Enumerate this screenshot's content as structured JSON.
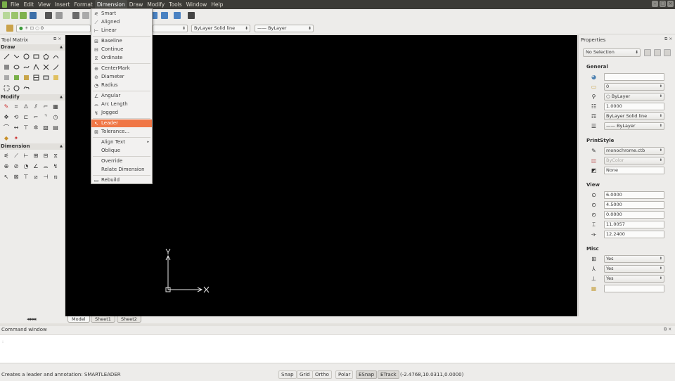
{
  "menubar": {
    "items": [
      "File",
      "Edit",
      "View",
      "Insert",
      "Format",
      "Dimension",
      "Draw",
      "Modify",
      "Tools",
      "Window",
      "Help"
    ],
    "active": "Dimension"
  },
  "toolbar2": {
    "layer_value": "0",
    "color_value": "ByLayer",
    "linetype_value": "ByLayer   Solid line",
    "lineweight_value": "—— ByLayer"
  },
  "left_panel": {
    "title": "Tool Matrix",
    "sections": [
      "Draw",
      "Modify",
      "Dimension"
    ]
  },
  "sheet_nav": "◂◂◂◂◂",
  "tabs": [
    "Model",
    "Sheet1",
    "Sheet2"
  ],
  "dimension_menu": {
    "items": [
      {
        "label": "Smart",
        "icon": "smart-dimension-icon"
      },
      {
        "label": "Aligned",
        "icon": "aligned-icon"
      },
      {
        "label": "Linear",
        "icon": "linear-icon"
      },
      {
        "label": "Baseline",
        "icon": "baseline-icon"
      },
      {
        "label": "Continue",
        "icon": "continue-icon"
      },
      {
        "label": "Ordinate",
        "icon": "ordinate-icon"
      },
      {
        "label": "CenterMark",
        "icon": "centermark-icon"
      },
      {
        "label": "Diameter",
        "icon": "diameter-icon"
      },
      {
        "label": "Radius",
        "icon": "radius-icon"
      },
      {
        "label": "Angular",
        "icon": "angular-icon"
      },
      {
        "label": "Arc Length",
        "icon": "arc-length-icon"
      },
      {
        "label": "Jogged",
        "icon": "jogged-icon"
      },
      {
        "label": "Leader",
        "icon": "leader-icon"
      },
      {
        "label": "Tolerance...",
        "icon": "tolerance-icon"
      },
      {
        "label": "Align Text",
        "icon": ""
      },
      {
        "label": "Oblique",
        "icon": ""
      },
      {
        "label": "Override",
        "icon": ""
      },
      {
        "label": "Relate Dimension",
        "icon": ""
      },
      {
        "label": "Rebuild",
        "icon": "rebuild-icon"
      }
    ],
    "highlighted": "Leader"
  },
  "properties": {
    "title": "Properties",
    "selection": "No Selection",
    "general": {
      "label": "General",
      "color": "",
      "layer": "0",
      "linetype_scale_source": "ByLayer",
      "linetype_scale": "1.0000",
      "linetype": "ByLayer   Solid line",
      "lineweight": "—— ByLayer"
    },
    "printstyle": {
      "label": "PrintStyle",
      "table": "monochrome.ctb",
      "style": "ByColor",
      "plot": "None"
    },
    "view": {
      "label": "View",
      "center_x": "6.0000",
      "center_y": "4.5000",
      "center_z": "0.0000",
      "height": "11.0057",
      "width": "12.2400"
    },
    "misc": {
      "label": "Misc",
      "ucs_icon_on": "Yes",
      "ucs_per_viewport": "Yes",
      "ucs_at_origin": "Yes",
      "ucs_name": ""
    }
  },
  "command_window": {
    "title": "Command window",
    "content": ""
  },
  "status": {
    "message": "Creates a leader and annotation:  SMARTLEADER",
    "buttons": [
      "Snap",
      "Grid",
      "Ortho",
      "Polar",
      "ESnap",
      "ETrack"
    ],
    "active_buttons": [
      "ESnap",
      "ETrack"
    ],
    "coords": "(-2.4768,10.0311,0.0000)"
  },
  "colors": {
    "canvas": "#000000",
    "menu_highlight": "#f07746",
    "menubar": "#3c3b37"
  }
}
